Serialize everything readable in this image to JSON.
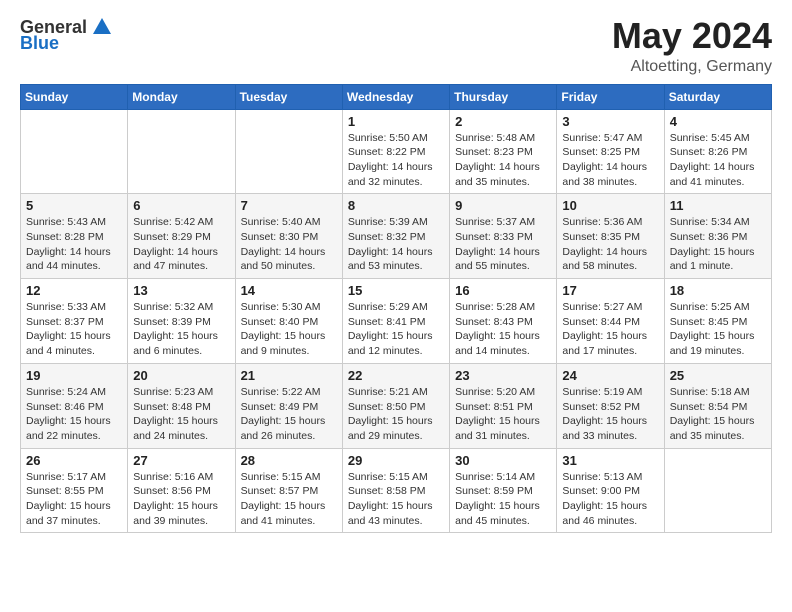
{
  "header": {
    "logo_general": "General",
    "logo_blue": "Blue",
    "month_title": "May 2024",
    "location": "Altoetting, Germany"
  },
  "days_of_week": [
    "Sunday",
    "Monday",
    "Tuesday",
    "Wednesday",
    "Thursday",
    "Friday",
    "Saturday"
  ],
  "weeks": [
    [
      {
        "day": "",
        "info": ""
      },
      {
        "day": "",
        "info": ""
      },
      {
        "day": "",
        "info": ""
      },
      {
        "day": "1",
        "info": "Sunrise: 5:50 AM\nSunset: 8:22 PM\nDaylight: 14 hours\nand 32 minutes."
      },
      {
        "day": "2",
        "info": "Sunrise: 5:48 AM\nSunset: 8:23 PM\nDaylight: 14 hours\nand 35 minutes."
      },
      {
        "day": "3",
        "info": "Sunrise: 5:47 AM\nSunset: 8:25 PM\nDaylight: 14 hours\nand 38 minutes."
      },
      {
        "day": "4",
        "info": "Sunrise: 5:45 AM\nSunset: 8:26 PM\nDaylight: 14 hours\nand 41 minutes."
      }
    ],
    [
      {
        "day": "5",
        "info": "Sunrise: 5:43 AM\nSunset: 8:28 PM\nDaylight: 14 hours\nand 44 minutes."
      },
      {
        "day": "6",
        "info": "Sunrise: 5:42 AM\nSunset: 8:29 PM\nDaylight: 14 hours\nand 47 minutes."
      },
      {
        "day": "7",
        "info": "Sunrise: 5:40 AM\nSunset: 8:30 PM\nDaylight: 14 hours\nand 50 minutes."
      },
      {
        "day": "8",
        "info": "Sunrise: 5:39 AM\nSunset: 8:32 PM\nDaylight: 14 hours\nand 53 minutes."
      },
      {
        "day": "9",
        "info": "Sunrise: 5:37 AM\nSunset: 8:33 PM\nDaylight: 14 hours\nand 55 minutes."
      },
      {
        "day": "10",
        "info": "Sunrise: 5:36 AM\nSunset: 8:35 PM\nDaylight: 14 hours\nand 58 minutes."
      },
      {
        "day": "11",
        "info": "Sunrise: 5:34 AM\nSunset: 8:36 PM\nDaylight: 15 hours\nand 1 minute."
      }
    ],
    [
      {
        "day": "12",
        "info": "Sunrise: 5:33 AM\nSunset: 8:37 PM\nDaylight: 15 hours\nand 4 minutes."
      },
      {
        "day": "13",
        "info": "Sunrise: 5:32 AM\nSunset: 8:39 PM\nDaylight: 15 hours\nand 6 minutes."
      },
      {
        "day": "14",
        "info": "Sunrise: 5:30 AM\nSunset: 8:40 PM\nDaylight: 15 hours\nand 9 minutes."
      },
      {
        "day": "15",
        "info": "Sunrise: 5:29 AM\nSunset: 8:41 PM\nDaylight: 15 hours\nand 12 minutes."
      },
      {
        "day": "16",
        "info": "Sunrise: 5:28 AM\nSunset: 8:43 PM\nDaylight: 15 hours\nand 14 minutes."
      },
      {
        "day": "17",
        "info": "Sunrise: 5:27 AM\nSunset: 8:44 PM\nDaylight: 15 hours\nand 17 minutes."
      },
      {
        "day": "18",
        "info": "Sunrise: 5:25 AM\nSunset: 8:45 PM\nDaylight: 15 hours\nand 19 minutes."
      }
    ],
    [
      {
        "day": "19",
        "info": "Sunrise: 5:24 AM\nSunset: 8:46 PM\nDaylight: 15 hours\nand 22 minutes."
      },
      {
        "day": "20",
        "info": "Sunrise: 5:23 AM\nSunset: 8:48 PM\nDaylight: 15 hours\nand 24 minutes."
      },
      {
        "day": "21",
        "info": "Sunrise: 5:22 AM\nSunset: 8:49 PM\nDaylight: 15 hours\nand 26 minutes."
      },
      {
        "day": "22",
        "info": "Sunrise: 5:21 AM\nSunset: 8:50 PM\nDaylight: 15 hours\nand 29 minutes."
      },
      {
        "day": "23",
        "info": "Sunrise: 5:20 AM\nSunset: 8:51 PM\nDaylight: 15 hours\nand 31 minutes."
      },
      {
        "day": "24",
        "info": "Sunrise: 5:19 AM\nSunset: 8:52 PM\nDaylight: 15 hours\nand 33 minutes."
      },
      {
        "day": "25",
        "info": "Sunrise: 5:18 AM\nSunset: 8:54 PM\nDaylight: 15 hours\nand 35 minutes."
      }
    ],
    [
      {
        "day": "26",
        "info": "Sunrise: 5:17 AM\nSunset: 8:55 PM\nDaylight: 15 hours\nand 37 minutes."
      },
      {
        "day": "27",
        "info": "Sunrise: 5:16 AM\nSunset: 8:56 PM\nDaylight: 15 hours\nand 39 minutes."
      },
      {
        "day": "28",
        "info": "Sunrise: 5:15 AM\nSunset: 8:57 PM\nDaylight: 15 hours\nand 41 minutes."
      },
      {
        "day": "29",
        "info": "Sunrise: 5:15 AM\nSunset: 8:58 PM\nDaylight: 15 hours\nand 43 minutes."
      },
      {
        "day": "30",
        "info": "Sunrise: 5:14 AM\nSunset: 8:59 PM\nDaylight: 15 hours\nand 45 minutes."
      },
      {
        "day": "31",
        "info": "Sunrise: 5:13 AM\nSunset: 9:00 PM\nDaylight: 15 hours\nand 46 minutes."
      },
      {
        "day": "",
        "info": ""
      }
    ]
  ]
}
